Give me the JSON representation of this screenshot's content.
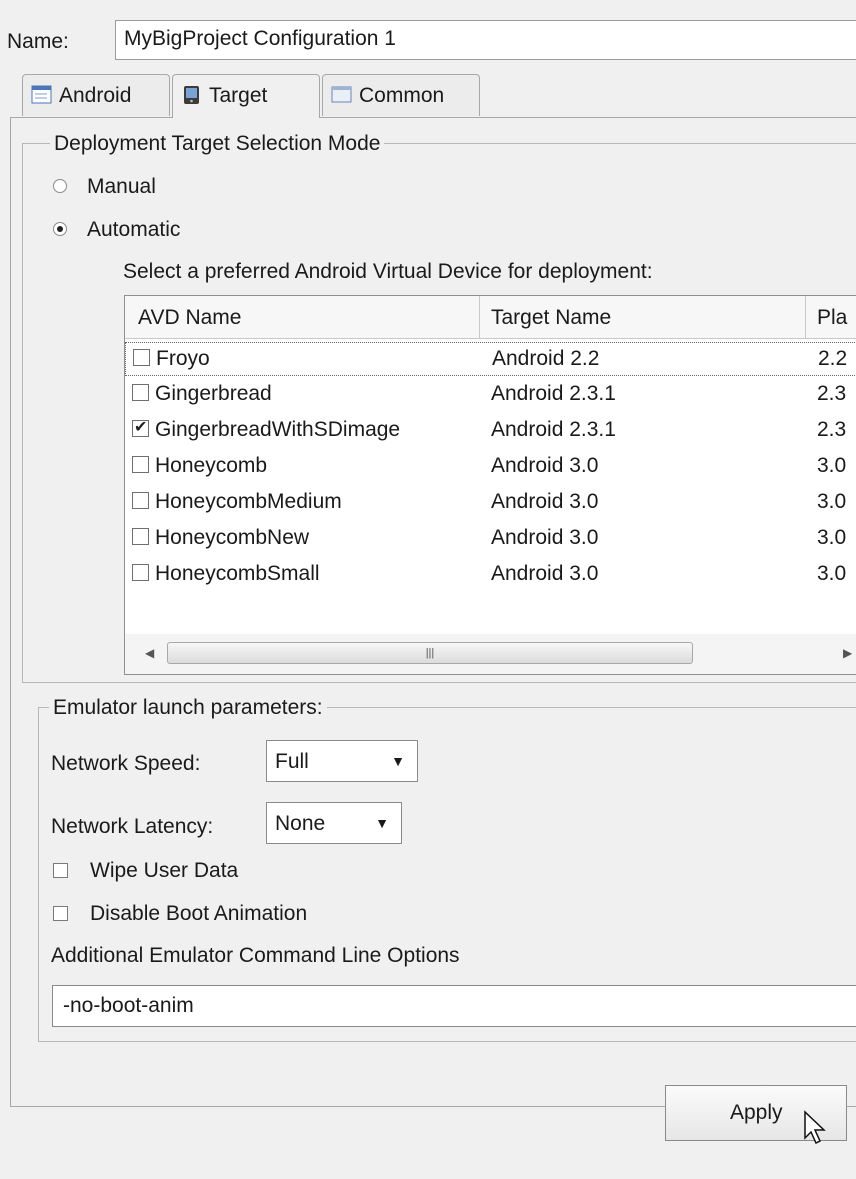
{
  "name_label": "Name:",
  "name_value": "MyBigProject Configuration 1",
  "tabs": [
    {
      "label": "Android",
      "icon": "android-tab-icon"
    },
    {
      "label": "Target",
      "icon": "target-tab-icon"
    },
    {
      "label": "Common",
      "icon": "common-tab-icon"
    }
  ],
  "deployment": {
    "title": "Deployment Target Selection Mode",
    "manual_label": "Manual",
    "automatic_label": "Automatic",
    "selected_mode": "Automatic",
    "avd_prompt": "Select a preferred Android Virtual Device for deployment:"
  },
  "avd_table": {
    "headers": [
      "AVD Name",
      "Target Name",
      "Pla"
    ],
    "rows": [
      {
        "name": "Froyo",
        "target": "Android 2.2",
        "platform": "2.2",
        "checked": false
      },
      {
        "name": "Gingerbread",
        "target": "Android 2.3.1",
        "platform": "2.3",
        "checked": false
      },
      {
        "name": "GingerbreadWithSDimage",
        "target": "Android 2.3.1",
        "platform": "2.3",
        "checked": true
      },
      {
        "name": "Honeycomb",
        "target": "Android 3.0",
        "platform": "3.0",
        "checked": false
      },
      {
        "name": "HoneycombMedium",
        "target": "Android 3.0",
        "platform": "3.0",
        "checked": false
      },
      {
        "name": "HoneycombNew",
        "target": "Android 3.0",
        "platform": "3.0",
        "checked": false
      },
      {
        "name": "HoneycombSmall",
        "target": "Android 3.0",
        "platform": "3.0",
        "checked": false
      }
    ]
  },
  "emulator": {
    "title": "Emulator launch parameters:",
    "network_speed_label": "Network Speed:",
    "network_speed_value": "Full",
    "network_latency_label": "Network Latency:",
    "network_latency_value": "None",
    "wipe_user_data_label": "Wipe User Data",
    "disable_boot_animation_label": "Disable Boot Animation",
    "additional_options_label": "Additional Emulator Command Line Options",
    "additional_options_value": "-no-boot-anim"
  },
  "apply_label": "Apply"
}
